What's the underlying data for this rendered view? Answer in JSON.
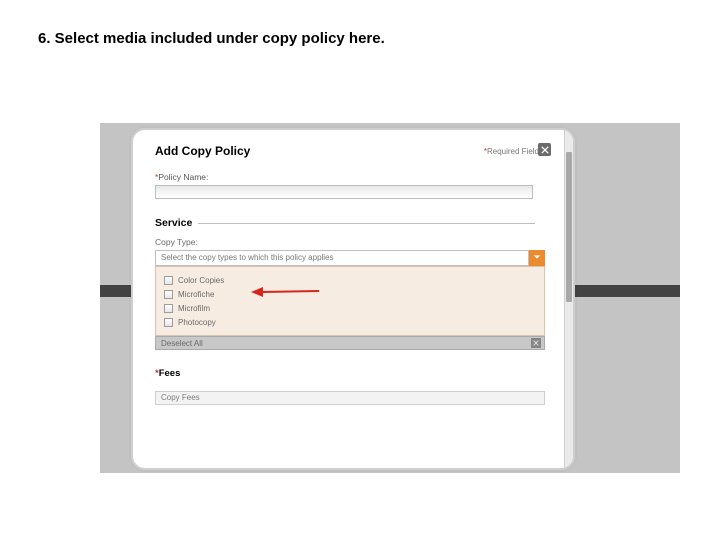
{
  "step": {
    "text": "6.  Select media included under copy policy here."
  },
  "modal": {
    "title": "Add Copy Policy",
    "required_note": "Required Fields",
    "asterisk": "*",
    "policy_name_label": "Policy Name:",
    "section_service": "Service",
    "copy_type_label": "Copy Type:",
    "dropdown_placeholder": "Select the copy types to which this policy applies",
    "options": {
      "o1": "Color Copies",
      "o2": "Microfiche",
      "o3": "Microfilm",
      "o4": "Photocopy"
    },
    "deselect_label": "Deselect All",
    "fees_label": "Fees",
    "peek_label": "Copy Fees"
  }
}
